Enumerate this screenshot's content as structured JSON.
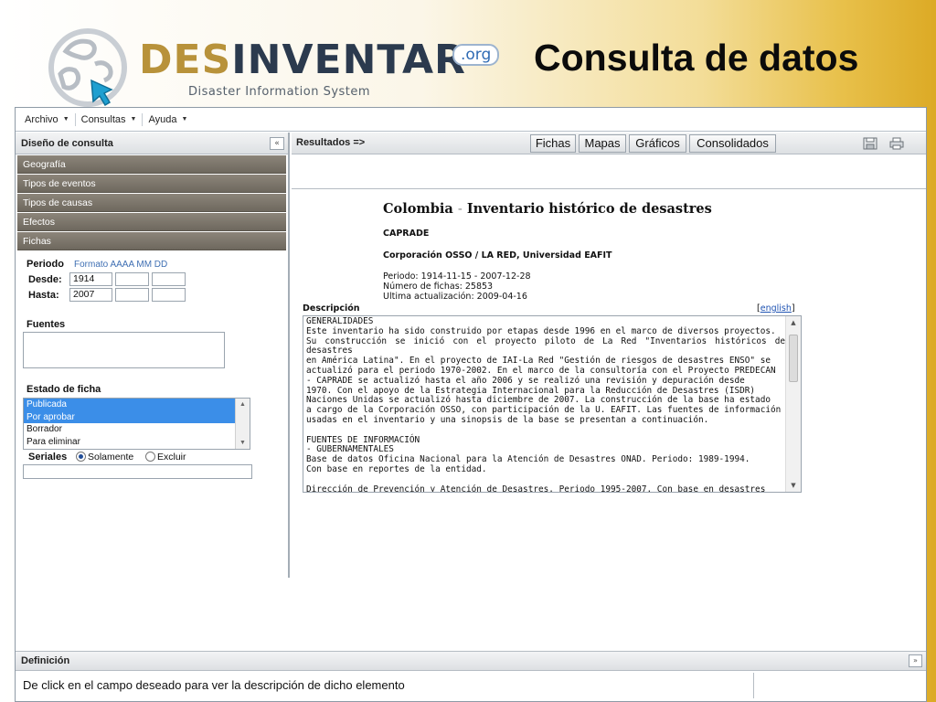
{
  "header": {
    "brand_part1": "DES",
    "brand_part2": "INVENTAR",
    "org_badge": ".org",
    "tagline": "Disaster Information System",
    "slide_title": "Consulta de datos"
  },
  "menubar": {
    "items": [
      {
        "label": "Archivo"
      },
      {
        "label": "Consultas"
      },
      {
        "label": "Ayuda"
      }
    ]
  },
  "left_panel": {
    "title": "Diseño de consulta",
    "accordion": [
      {
        "label": "Geografía"
      },
      {
        "label": "Tipos de eventos"
      },
      {
        "label": "Tipos de causas"
      },
      {
        "label": "Efectos"
      },
      {
        "label": "Fichas"
      }
    ],
    "periodo": {
      "label": "Periodo",
      "format_hint": "Formato AAAA MM DD",
      "desde_label": "Desde:",
      "hasta_label": "Hasta:",
      "desde_year": "1914",
      "desde_month": "",
      "desde_day": "",
      "hasta_year": "2007",
      "hasta_month": "",
      "hasta_day": ""
    },
    "fuentes": {
      "label": "Fuentes",
      "value": ""
    },
    "estado": {
      "label": "Estado de ficha",
      "options": [
        {
          "label": "Publicada",
          "selected": true
        },
        {
          "label": "Por aprobar",
          "selected": true
        },
        {
          "label": "Borrador",
          "selected": false
        },
        {
          "label": "Para eliminar",
          "selected": false
        }
      ]
    },
    "seriales": {
      "label": "Seriales",
      "option_only": "Solamente",
      "option_exclude": "Excluir",
      "selected": "Solamente",
      "value": ""
    }
  },
  "results": {
    "title": "Resultados =>",
    "tabs": [
      {
        "label": "Fichas"
      },
      {
        "label": "Mapas"
      },
      {
        "label": "Gráficos"
      },
      {
        "label": "Consolidados"
      }
    ],
    "icons": [
      "save-icon",
      "print-icon"
    ],
    "document": {
      "country": "Colombia",
      "separator": "-",
      "inventory_title": "Inventario histórico de desastres",
      "project": "CAPRADE",
      "organization": "Corporación OSSO / LA RED, Universidad EAFIT",
      "periodo": "Periodo: 1914-11-15 - 2007-12-28",
      "numero_fichas": "Número de fichas: 25853",
      "ultima_actualizacion": "Ultima actualización: 2009-04-16",
      "descripcion_label": "Descripción",
      "english_link": "english",
      "description_lines": [
        "GENERALIDADES",
        "Este inventario ha sido construido por etapas desde 1996 en el marco de diversos proyectos.",
        "Su construcción se inició con el proyecto piloto de La Red \"Inventarios históricos de desastres",
        "en América Latina\". En el proyecto de IAI-La Red \"Gestión de riesgos de desastres ENSO\" se",
        "actualizó para el periodo 1970-2002. En el marco de la consultoría con el Proyecto PREDECAN",
        "- CAPRADE se actualizó hasta el año 2006 y se realizó una revisión y depuración desde",
        "1970. Con el apoyo de la Estrategia Internacional para la Reducción de Desastres (ISDR)",
        "Naciones Unidas se actualizó hasta diciembre de 2007. La construcción de la base ha estado",
        "a cargo de la Corporación OSSO, con participación de la U. EAFIT. Las fuentes de información",
        "usadas en el inventario y una sinopsis de la base se presentan a continuación.",
        "",
        "FUENTES DE INFORMACIÓN",
        "- GUBERNAMENTALES",
        "Base de datos Oficina Nacional para la Atención de Desastres ONAD. Periodo: 1989-1994.",
        "Con base en reportes de la entidad.",
        "",
        "Dirección de Prevención y Atención de Desastres. Periodo 1995-2007. Con base en desastres"
      ]
    }
  },
  "definicion": {
    "title": "Definición",
    "text": "De click en el campo deseado para ver la descripción de dicho elemento"
  }
}
